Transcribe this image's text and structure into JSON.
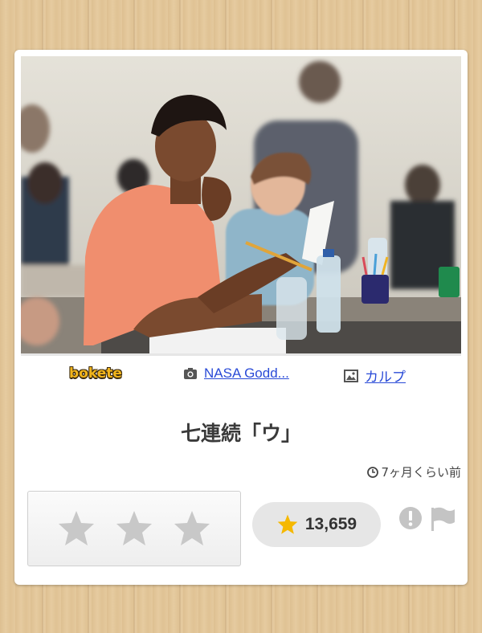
{
  "brand": {
    "logo_text": "bokete"
  },
  "credits": {
    "photo_by": "NASA Godd...",
    "image_by": "カルプ"
  },
  "post": {
    "caption": "七連続「ウ」",
    "posted_ago": "7ヶ月くらい前"
  },
  "rating": {
    "star_count": 3,
    "total_stars": "13,659"
  },
  "icons": {
    "camera": "camera-icon",
    "image": "image-icon",
    "clock": "clock-icon",
    "star": "star-icon",
    "report": "report-icon",
    "flag": "flag-icon"
  },
  "colors": {
    "link": "#2a4bd7",
    "logo": "#f2b51b",
    "star_active": "#f5b800",
    "star_inactive": "#c8c8c8"
  }
}
